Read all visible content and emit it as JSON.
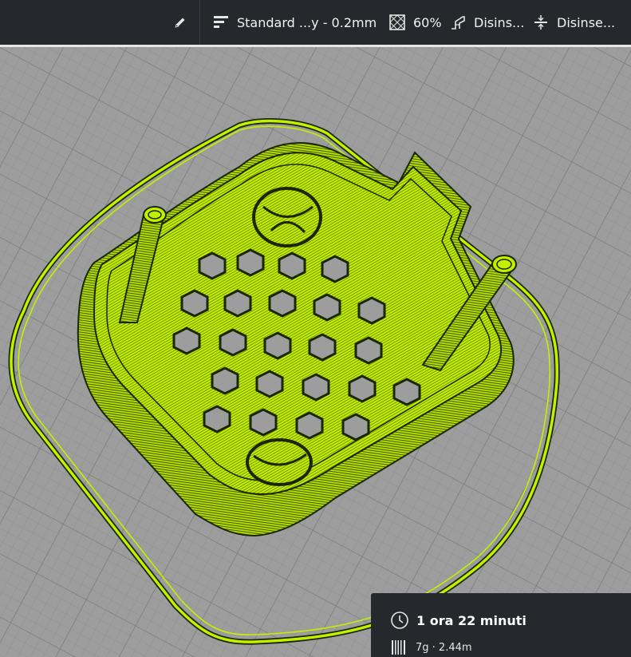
{
  "toolbar": {
    "edit_icon": "pencil-icon",
    "profile": {
      "icon": "layer-profile-icon",
      "label": "Standard ...y - 0.2mm"
    },
    "infill": {
      "icon": "infill-icon",
      "label": "60%"
    },
    "support": {
      "icon": "support-icon",
      "label": "Disins..."
    },
    "adhesion": {
      "icon": "adhesion-icon",
      "label": "Disinse..."
    }
  },
  "print_info": {
    "time_icon": "clock-icon",
    "time": "1 ora 22 minuti",
    "material_icon": "filament-spool-icon",
    "material": "7g · 2.44m"
  },
  "colors": {
    "toolbar_bg": "#25282c",
    "buildplate": "#9a9a9a",
    "model_layer": "#c3f000",
    "model_shadow": "#1a2600"
  }
}
